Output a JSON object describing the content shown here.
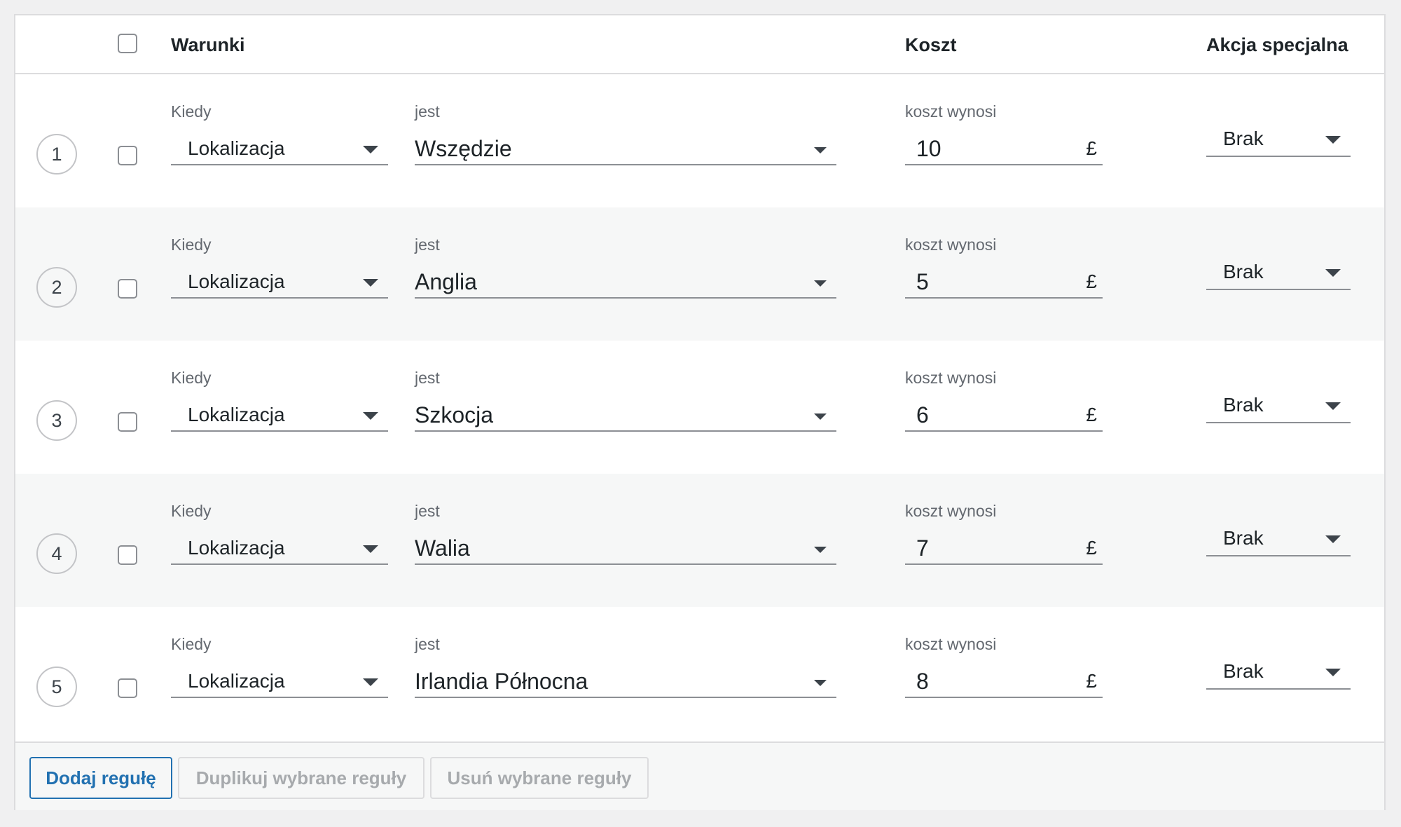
{
  "header": {
    "conditions": "Warunki",
    "cost": "Koszt",
    "special_action": "Akcja specjalna"
  },
  "rows": [
    {
      "num": "1",
      "when_label": "Kiedy",
      "when": "Lokalizacja",
      "is_label": "jest",
      "is": "Wszędzie",
      "cost_label": "koszt wynosi",
      "cost": "10",
      "currency": "£",
      "action": "Brak"
    },
    {
      "num": "2",
      "when_label": "Kiedy",
      "when": "Lokalizacja",
      "is_label": "jest",
      "is": "Anglia",
      "cost_label": "koszt wynosi",
      "cost": "5",
      "currency": "£",
      "action": "Brak"
    },
    {
      "num": "3",
      "when_label": "Kiedy",
      "when": "Lokalizacja",
      "is_label": "jest",
      "is": "Szkocja",
      "cost_label": "koszt wynosi",
      "cost": "6",
      "currency": "£",
      "action": "Brak"
    },
    {
      "num": "4",
      "when_label": "Kiedy",
      "when": "Lokalizacja",
      "is_label": "jest",
      "is": "Walia",
      "cost_label": "koszt wynosi",
      "cost": "7",
      "currency": "£",
      "action": "Brak"
    },
    {
      "num": "5",
      "when_label": "Kiedy",
      "when": "Lokalizacja",
      "is_label": "jest",
      "is": "Irlandia Północna",
      "cost_label": "koszt wynosi",
      "cost": "8",
      "currency": "£",
      "action": "Brak"
    }
  ],
  "footer": {
    "add_rule": "Dodaj regułę",
    "duplicate_selected": "Duplikuj wybrane reguły",
    "delete_selected": "Usuń wybrane reguły"
  },
  "colors": {
    "accent": "#2271b1",
    "border": "#dcdcde",
    "stripe": "#f6f7f7"
  }
}
